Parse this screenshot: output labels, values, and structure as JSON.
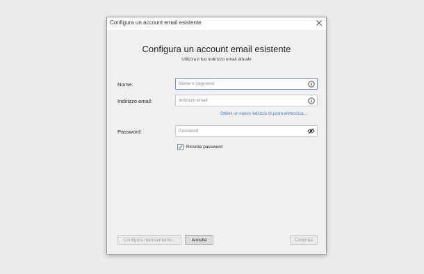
{
  "window": {
    "title": "Configura un account email esistente",
    "close_icon": "close-icon"
  },
  "header": {
    "heading": "Configura un account email esistente",
    "subheading": "Utilizza il tuo indirizzo email attuale"
  },
  "form": {
    "name": {
      "label": "Nome:",
      "placeholder": "Nome e cognome",
      "value": "",
      "icon": "info-icon"
    },
    "email": {
      "label": "Indirizzo email:",
      "placeholder": "Indirizzo email",
      "value": "",
      "icon": "info-icon"
    },
    "new_address_link": "Ottieni un nuovo indirizzo di posta elettronica...",
    "password": {
      "label": "Password:",
      "placeholder": "Password",
      "value": "",
      "icon": "eye-slash-icon"
    },
    "remember": {
      "label": "Ricorda password",
      "checked": true
    }
  },
  "footer": {
    "manual_config": "Configura manualmente...",
    "cancel": "Annulla",
    "continue": "Continua"
  },
  "colors": {
    "accent": "#3d7ad6",
    "focus_border": "#6a8fd8",
    "disabled_text": "#a0a0a0"
  }
}
